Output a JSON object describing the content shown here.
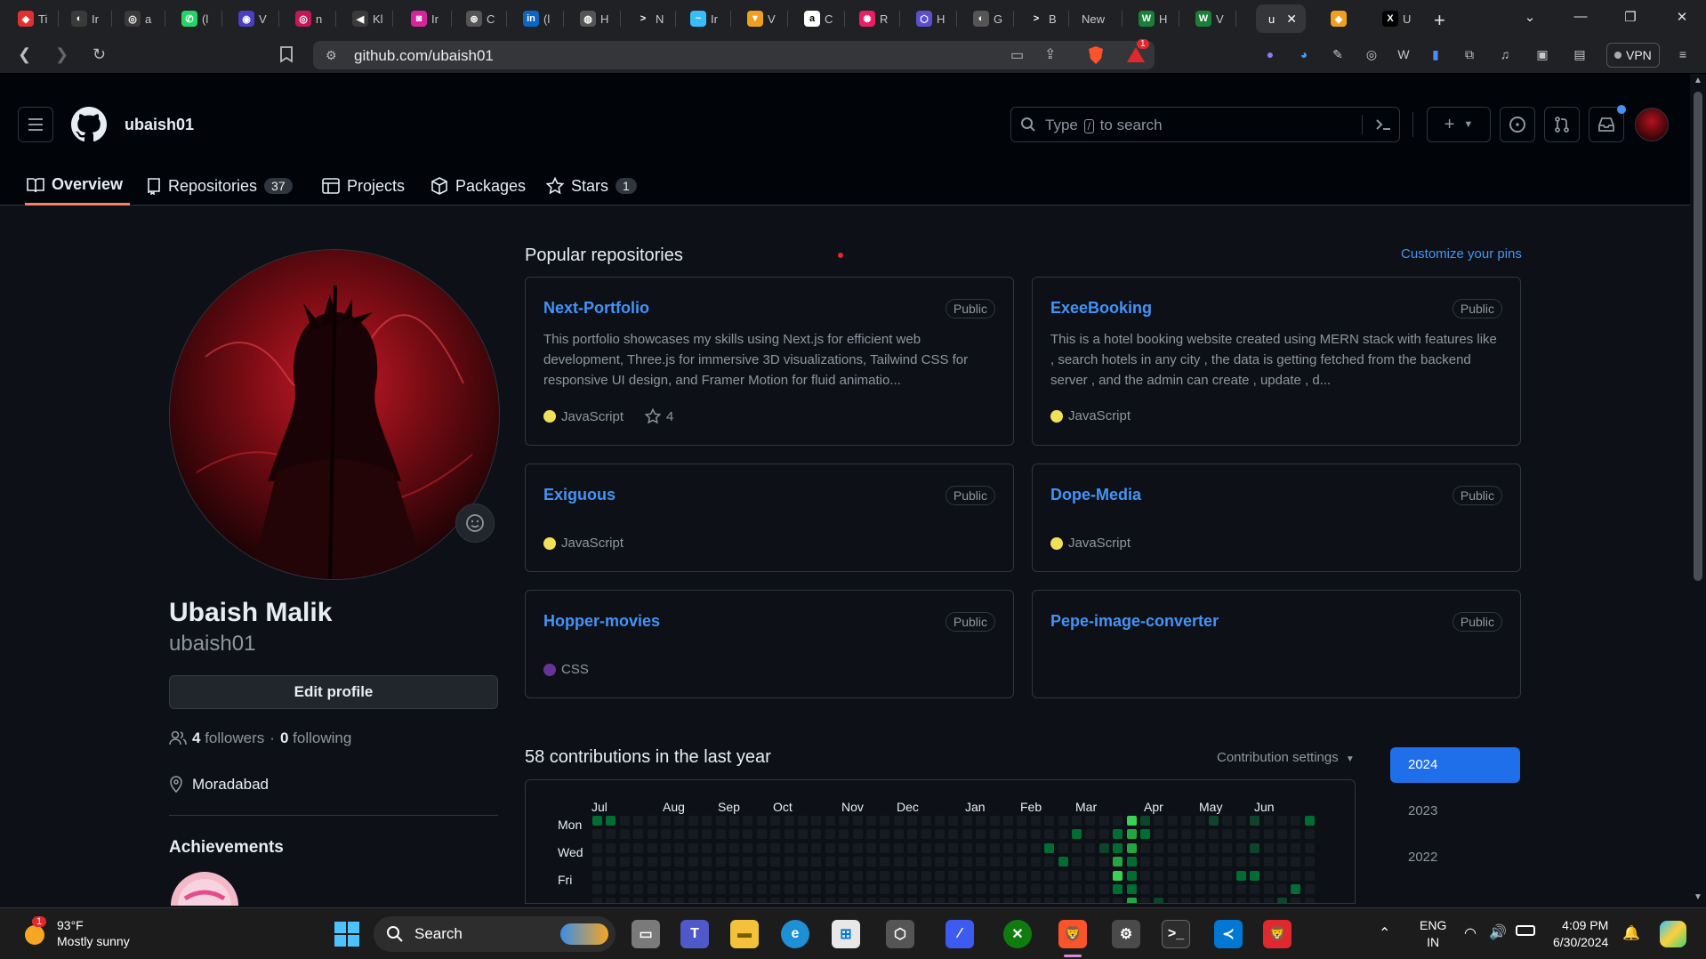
{
  "browser": {
    "tabs": [
      {
        "title": "Ti",
        "color": "#e03131",
        "glyph": "◆"
      },
      {
        "title": "Ir",
        "color": "#3a3a3a",
        "glyph": "◐"
      },
      {
        "title": "a",
        "color": "#3a3a3a",
        "glyph": "◎"
      },
      {
        "title": "(l",
        "color": "#25d366",
        "glyph": "✆"
      },
      {
        "title": "V",
        "color": "#4a3fbf",
        "glyph": "◉"
      },
      {
        "title": "n",
        "color": "#c2185b",
        "glyph": "◎"
      },
      {
        "title": "Kl",
        "color": "#3a3a3a",
        "glyph": "◀"
      },
      {
        "title": "Ir",
        "color": "#d6249f",
        "glyph": "◙"
      },
      {
        "title": "C",
        "color": "#555555",
        "glyph": "⊛"
      },
      {
        "title": "(l",
        "color": "#0a66c2",
        "glyph": "in"
      },
      {
        "title": "H",
        "color": "#555555",
        "glyph": "◍"
      },
      {
        "title": "N",
        "color": "#202124",
        "glyph": ">"
      },
      {
        "title": "Ir",
        "color": "#38bdf8",
        "glyph": "~"
      },
      {
        "title": "V",
        "color": "#f0a020",
        "glyph": "▼"
      },
      {
        "title": "C",
        "color": "#ffffff",
        "glyph": "a"
      },
      {
        "title": "R",
        "color": "#e91e63",
        "glyph": "✺"
      },
      {
        "title": "H",
        "color": "#5b4fd0",
        "glyph": "⬡"
      },
      {
        "title": "G",
        "color": "#555555",
        "glyph": "◐"
      },
      {
        "title": "B",
        "color": "#202124",
        "glyph": ">"
      },
      {
        "title": "New",
        "color": "",
        "glyph": ""
      },
      {
        "title": "H",
        "color": "#1a7f37",
        "glyph": "W"
      },
      {
        "title": "V",
        "color": "#1a7f37",
        "glyph": "W"
      }
    ],
    "active_tab": {
      "title": "u"
    },
    "last_tabs": [
      {
        "title": "",
        "color": "#f0a020",
        "glyph": "◆"
      },
      {
        "title": "U",
        "color": "#000000",
        "glyph": "X"
      }
    ],
    "url": "github.com/ubaish01",
    "notification_count": "1",
    "vpn_label": "VPN"
  },
  "github": {
    "username": "ubaish01",
    "search_placeholder_before": "Type",
    "search_placeholder_key": "/",
    "search_placeholder_after": "to search",
    "tabs": {
      "overview": "Overview",
      "repositories": "Repositories",
      "repositories_count": "37",
      "projects": "Projects",
      "packages": "Packages",
      "stars": "Stars",
      "stars_count": "1"
    }
  },
  "profile": {
    "full_name": "Ubaish Malik",
    "login": "ubaish01",
    "edit_button": "Edit profile",
    "followers_count": "4",
    "followers_label": "followers",
    "separator": "·",
    "following_count": "0",
    "following_label": "following",
    "location": "Moradabad",
    "achievements_title": "Achievements"
  },
  "popular": {
    "title": "Popular repositories",
    "customize_link": "Customize your pins",
    "repos": [
      {
        "name": "Next-Portfolio",
        "visibility": "Public",
        "description": "This portfolio showcases my skills using Next.js for efficient web development, Three.js for immersive 3D visualizations, Tailwind CSS for responsive UI design, and Framer Motion for fluid animatio...",
        "language": "JavaScript",
        "lang_color": "#f1e05a",
        "stars": "4"
      },
      {
        "name": "ExeeBooking",
        "visibility": "Public",
        "description": "This is a hotel booking website created using MERN stack with features like , search hotels in any city , the data is getting fetched from the backend server , and the admin can create , update , d...",
        "language": "JavaScript",
        "lang_color": "#f1e05a",
        "stars": ""
      },
      {
        "name": "Exiguous",
        "visibility": "Public",
        "description": "",
        "language": "JavaScript",
        "lang_color": "#f1e05a",
        "stars": ""
      },
      {
        "name": "Dope-Media",
        "visibility": "Public",
        "description": "",
        "language": "JavaScript",
        "lang_color": "#f1e05a",
        "stars": ""
      },
      {
        "name": "Hopper-movies",
        "visibility": "Public",
        "description": "",
        "language": "CSS",
        "lang_color": "#663399",
        "stars": ""
      },
      {
        "name": "Pepe-image-converter",
        "visibility": "Public",
        "description": "",
        "language": "",
        "lang_color": "",
        "stars": ""
      }
    ]
  },
  "contributions": {
    "title": "58 contributions in the last year",
    "settings_label": "Contribution settings",
    "months": [
      "Jul",
      "Aug",
      "Sep",
      "Oct",
      "Nov",
      "Dec",
      "Jan",
      "Feb",
      "Mar",
      "Apr",
      "May",
      "Jun"
    ],
    "days": [
      "Mon",
      "Wed",
      "Fri"
    ],
    "years": [
      "2024",
      "2023",
      "2022"
    ],
    "selected_year": "2024",
    "active_cells": [
      {
        "week": 0,
        "day": 0,
        "level": 2
      },
      {
        "week": 1,
        "day": 0,
        "level": 2
      },
      {
        "week": 35,
        "day": 1,
        "level": 2
      },
      {
        "week": 33,
        "day": 2,
        "level": 2
      },
      {
        "week": 34,
        "day": 3,
        "level": 2
      },
      {
        "week": 37,
        "day": 2,
        "level": 1
      },
      {
        "week": 38,
        "day": 2,
        "level": 2
      },
      {
        "week": 38,
        "day": 3,
        "level": 3
      },
      {
        "week": 38,
        "day": 4,
        "level": 4
      },
      {
        "week": 38,
        "day": 5,
        "level": 2
      },
      {
        "week": 39,
        "day": 0,
        "level": 4
      },
      {
        "week": 39,
        "day": 1,
        "level": 3
      },
      {
        "week": 39,
        "day": 2,
        "level": 3
      },
      {
        "week": 39,
        "day": 3,
        "level": 2
      },
      {
        "week": 39,
        "day": 4,
        "level": 2
      },
      {
        "week": 39,
        "day": 5,
        "level": 2
      },
      {
        "week": 39,
        "day": 6,
        "level": 3
      },
      {
        "week": 38,
        "day": 1,
        "level": 2
      },
      {
        "week": 40,
        "day": 0,
        "level": 1
      },
      {
        "week": 40,
        "day": 1,
        "level": 2
      },
      {
        "week": 41,
        "day": 6,
        "level": 1
      },
      {
        "week": 45,
        "day": 0,
        "level": 1
      },
      {
        "week": 47,
        "day": 4,
        "level": 2
      },
      {
        "week": 48,
        "day": 4,
        "level": 2
      },
      {
        "week": 48,
        "day": 0,
        "level": 1
      },
      {
        "week": 48,
        "day": 2,
        "level": 1
      },
      {
        "week": 51,
        "day": 5,
        "level": 2
      },
      {
        "week": 50,
        "day": 6,
        "level": 1
      },
      {
        "week": 52,
        "day": 0,
        "level": 2
      }
    ]
  },
  "taskbar": {
    "weather_temp": "93°F",
    "weather_desc": "Mostly sunny",
    "weather_badge": "1",
    "search_label": "Search",
    "lang_top": "ENG",
    "lang_bottom": "IN",
    "time": "4:09 PM",
    "date": "6/30/2024"
  }
}
